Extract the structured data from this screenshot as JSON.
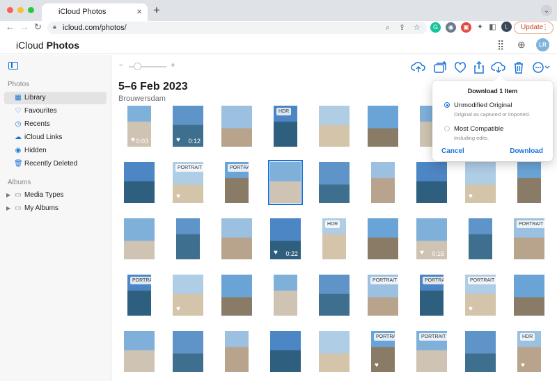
{
  "browser": {
    "tab_title": "iCloud Photos",
    "new_tab_label": "+",
    "url": "icloud.com/photos/",
    "profile_initial": "L",
    "update_label": "Update"
  },
  "app": {
    "name_prefix": "iCloud",
    "name": "Photos",
    "avatar_initials": "LR"
  },
  "sidebar": {
    "photos_heading": "Photos",
    "albums_heading": "Albums",
    "items": [
      {
        "label": "Library",
        "icon": "library-icon"
      },
      {
        "label": "Favourites",
        "icon": "heart-icon"
      },
      {
        "label": "Recents",
        "icon": "clock-icon"
      },
      {
        "label": "iCloud Links",
        "icon": "cloud-link-icon"
      },
      {
        "label": "Hidden",
        "icon": "eye-icon"
      },
      {
        "label": "Recently Deleted",
        "icon": "trash-icon"
      }
    ],
    "album_items": [
      {
        "label": "Media Types",
        "icon": "folder-icon"
      },
      {
        "label": "My Albums",
        "icon": "folder-icon"
      }
    ]
  },
  "main": {
    "date": "5–6 Feb 2023",
    "place": "Brouwersdam"
  },
  "download_popover": {
    "title": "Download 1 Item",
    "option1_label": "Unmodified Original",
    "option1_sub": "Original as captured or imported.",
    "option2_label": "Most Compatible",
    "option2_sub": "Including edits.",
    "selected": "Unmodified Original",
    "cancel_label": "Cancel",
    "download_label": "Download"
  },
  "grid": {
    "rows": [
      [
        {
          "heart": true,
          "duration": "0:03"
        },
        {
          "heart": true,
          "duration": "0:12"
        },
        {},
        {
          "badge": "HDR"
        },
        {},
        {},
        {},
        {},
        {}
      ],
      [
        {},
        {
          "badge": "PORTRAIT",
          "heart": true
        },
        {
          "badge": "PORTRAIT"
        },
        {
          "selected": true
        },
        {},
        {},
        {},
        {
          "heart": true
        },
        {}
      ],
      [
        {},
        {},
        {},
        {
          "heart": true,
          "duration": "0:22"
        },
        {
          "badge": "HDR"
        },
        {},
        {
          "heart": true,
          "duration": "0:15"
        },
        {},
        {
          "badge": "PORTRAIT"
        }
      ],
      [
        {
          "badge": "PORTRAIT"
        },
        {
          "heart": true
        },
        {},
        {},
        {},
        {
          "badge": "PORTRAIT"
        },
        {
          "badge": "PORTRAIT"
        },
        {
          "badge": "PORTRAIT",
          "heart": true
        },
        {}
      ],
      [
        {},
        {},
        {},
        {},
        {},
        {
          "badge": "PORTRAIT",
          "heart": true
        },
        {
          "badge": "PORTRAIT"
        },
        {},
        {
          "badge": "HDR",
          "heart": true
        }
      ]
    ]
  }
}
